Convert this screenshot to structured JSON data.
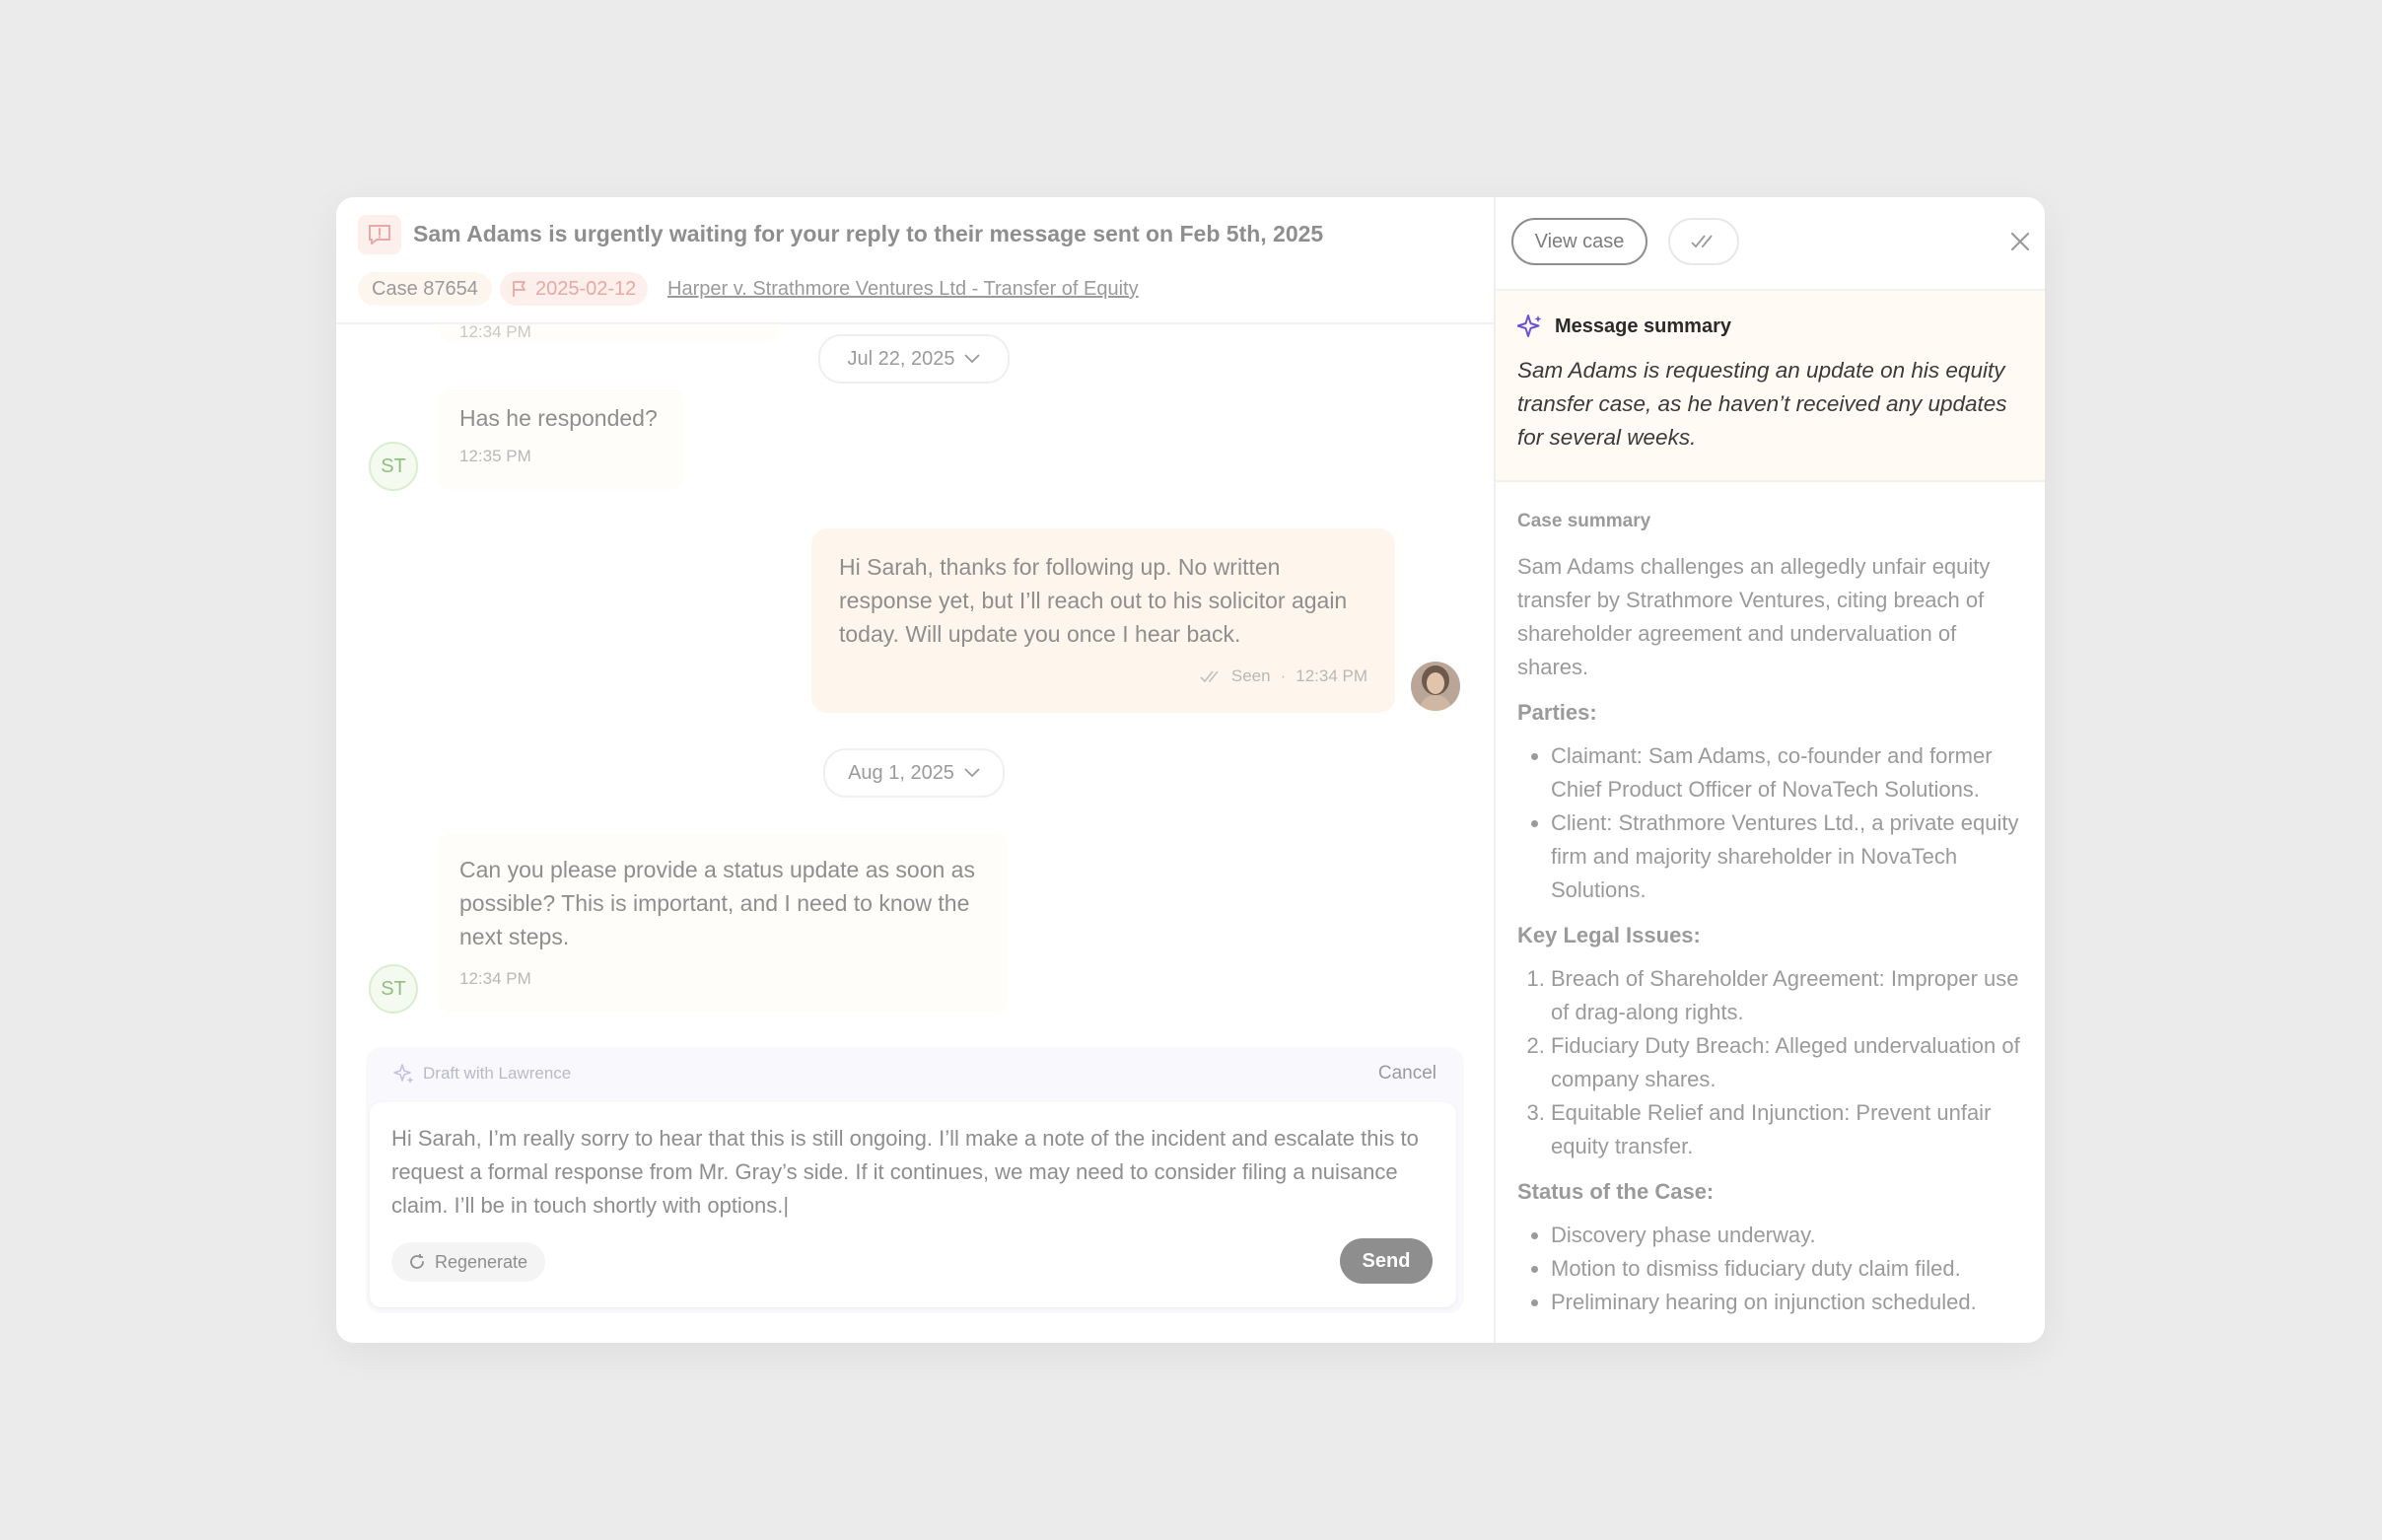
{
  "header": {
    "title": "Sam Adams is urgently waiting for your reply to their message sent on Feb 5th, 2025",
    "case_number": "Case 87654",
    "flag_date": "2025-02-12",
    "case_link": "Harper v. Strathmore Ventures Ltd - Transfer of Equity"
  },
  "chat": {
    "partial_time": "12:34 PM",
    "date1": "Jul 22, 2025",
    "msg1": {
      "text": "Has he responded?",
      "time": "12:35 PM",
      "avatar": "ST"
    },
    "msg2": {
      "text": "Hi Sarah, thanks for following up. No written response yet, but I’ll reach out to his solicitor again today. Will update you once I hear back.",
      "status": "Seen",
      "separator": "·",
      "time": "12:34 PM"
    },
    "date2": "Aug 1, 2025",
    "msg3": {
      "text": "Can you please provide a status update as soon as possible? This is important, and I need to know the next steps.",
      "time": "12:34 PM",
      "avatar": "ST"
    }
  },
  "draft": {
    "label": "Draft with Lawrence",
    "cancel": "Cancel",
    "text": "Hi Sarah, I’m really sorry to hear that this is still ongoing. I’ll make a note of the incident and escalate this to request a formal response from Mr. Gray’s side. If it continues, we may need to consider filing a nuisance claim. I’ll be in touch shortly with options.|",
    "regenerate": "Regenerate",
    "send": "Send"
  },
  "panel": {
    "view_case": "View case",
    "message_summary_title": "Message summary",
    "message_summary": "Sam Adams is requesting an update on his equity transfer case, as he haven’t received any updates for several weeks.",
    "case_summary_title": "Case summary",
    "case_summary": "Sam Adams challenges an allegedly unfair equity transfer by Strathmore Ventures, citing breach of shareholder agreement and undervaluation of shares.",
    "parties_title": "Parties:",
    "parties": [
      "Claimant: Sam Adams, co-founder and former Chief Product Officer of NovaTech Solutions.",
      "Client: Strathmore Ventures Ltd., a private equity firm and majority shareholder in NovaTech Solutions."
    ],
    "issues_title": "Key Legal Issues:",
    "issues": [
      "Breach of Shareholder Agreement: Improper use of drag-along rights.",
      "Fiduciary Duty Breach: Alleged undervaluation of company shares.",
      "Equitable Relief and Injunction: Prevent unfair equity transfer."
    ],
    "status_title": "Status of the Case:",
    "status": [
      "Discovery phase underway.",
      "Motion to dismiss fiduciary duty claim filed.",
      "Preliminary hearing on injunction scheduled."
    ]
  },
  "colors": {
    "accent_sparkle": "#6c4fd8",
    "alert": "#e8a8a3",
    "send_button": "#8e8e8e"
  }
}
